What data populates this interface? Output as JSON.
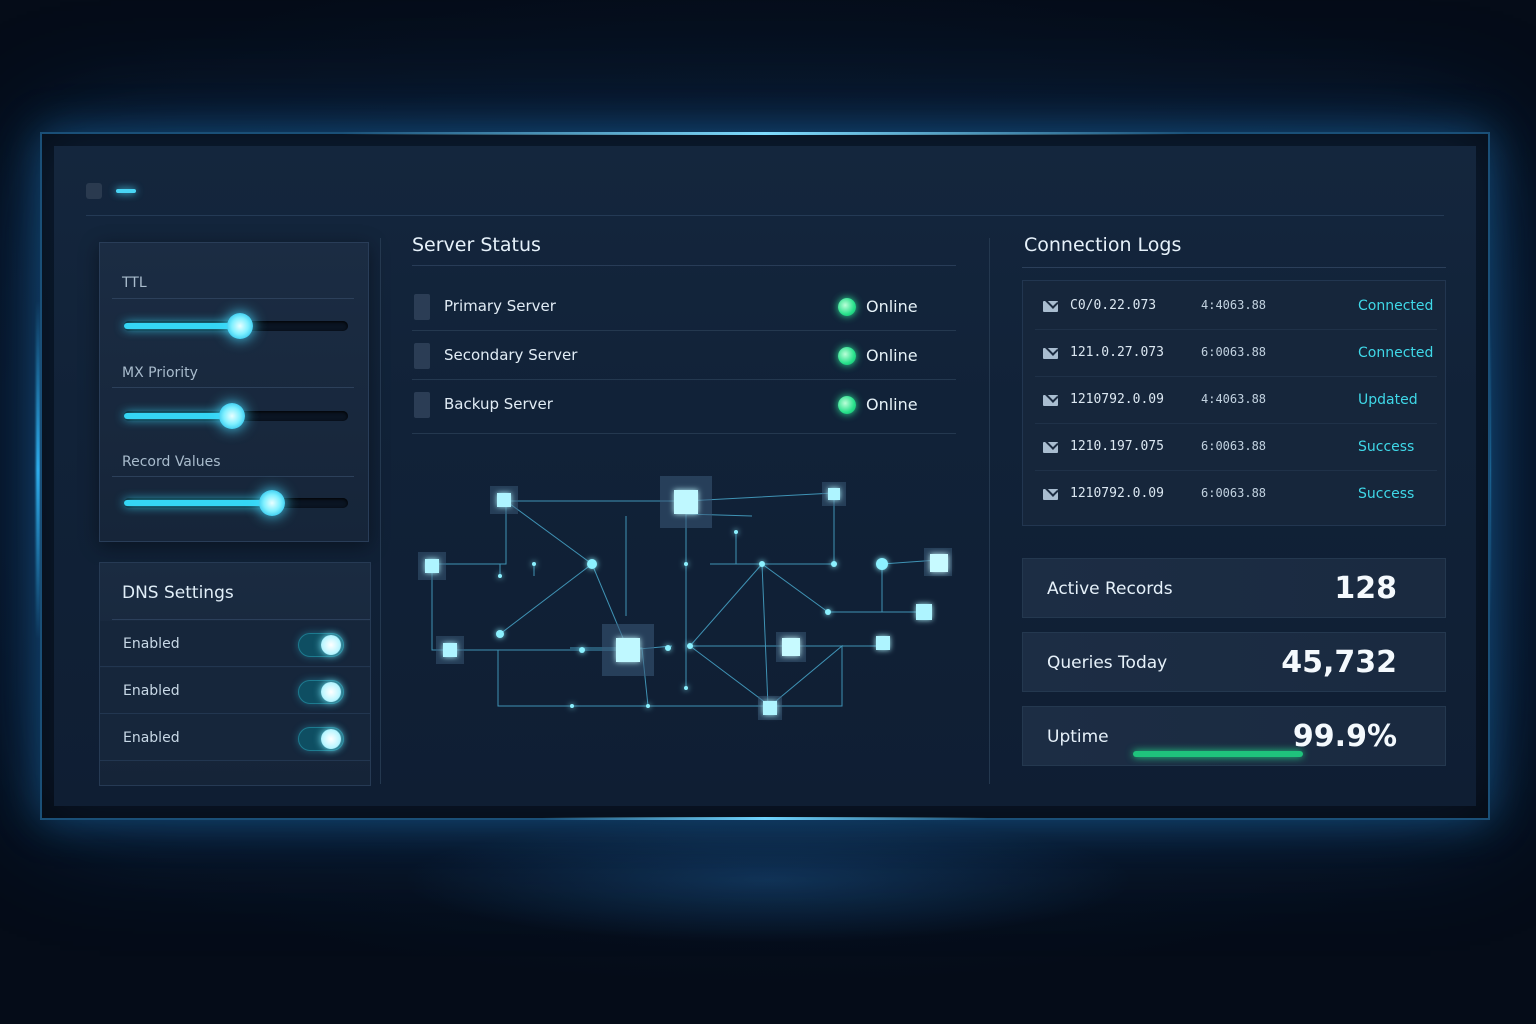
{
  "sliders": [
    {
      "label": "TTL",
      "value": 0.52
    },
    {
      "label": "MX Priority",
      "value": 0.48
    },
    {
      "label": "Record Values",
      "value": 0.66
    }
  ],
  "dns": {
    "title": "DNS Settings",
    "items": [
      {
        "label": "Enabled",
        "on": true
      },
      {
        "label": "Enabled",
        "on": true
      },
      {
        "label": "Enabled",
        "on": true
      }
    ]
  },
  "server_status": {
    "title": "Server Status",
    "rows": [
      {
        "name": "Primary Server",
        "status": "Online"
      },
      {
        "name": "Secondary Server",
        "status": "Online"
      },
      {
        "name": "Backup Server",
        "status": "Online"
      }
    ],
    "status_color": "#26e08a"
  },
  "logs": {
    "title": "Connection Logs",
    "rows": [
      {
        "ip": "C0/0.22.073",
        "time": "4:4063.88",
        "status": "Connected"
      },
      {
        "ip": "121.0.27.073",
        "time": "6:0063.88",
        "status": "Connected"
      },
      {
        "ip": "1210792.0.09",
        "time": "4:4063.88",
        "status": "Updated"
      },
      {
        "ip": "1210.197.075",
        "time": "6:0063.88",
        "status": "Success"
      },
      {
        "ip": "1210792.0.09",
        "time": "6:0063.88",
        "status": "Success"
      }
    ]
  },
  "stats": {
    "active_records": {
      "label": "Active Records",
      "value": "128"
    },
    "queries_today": {
      "label": "Queries Today",
      "value": "45,732"
    },
    "uptime": {
      "label": "Uptime",
      "value": "99.9%",
      "bar_fraction": 0.999
    }
  },
  "colors": {
    "accent": "#35d6f5",
    "success": "#26e08a",
    "background": "#0b1a2e"
  }
}
